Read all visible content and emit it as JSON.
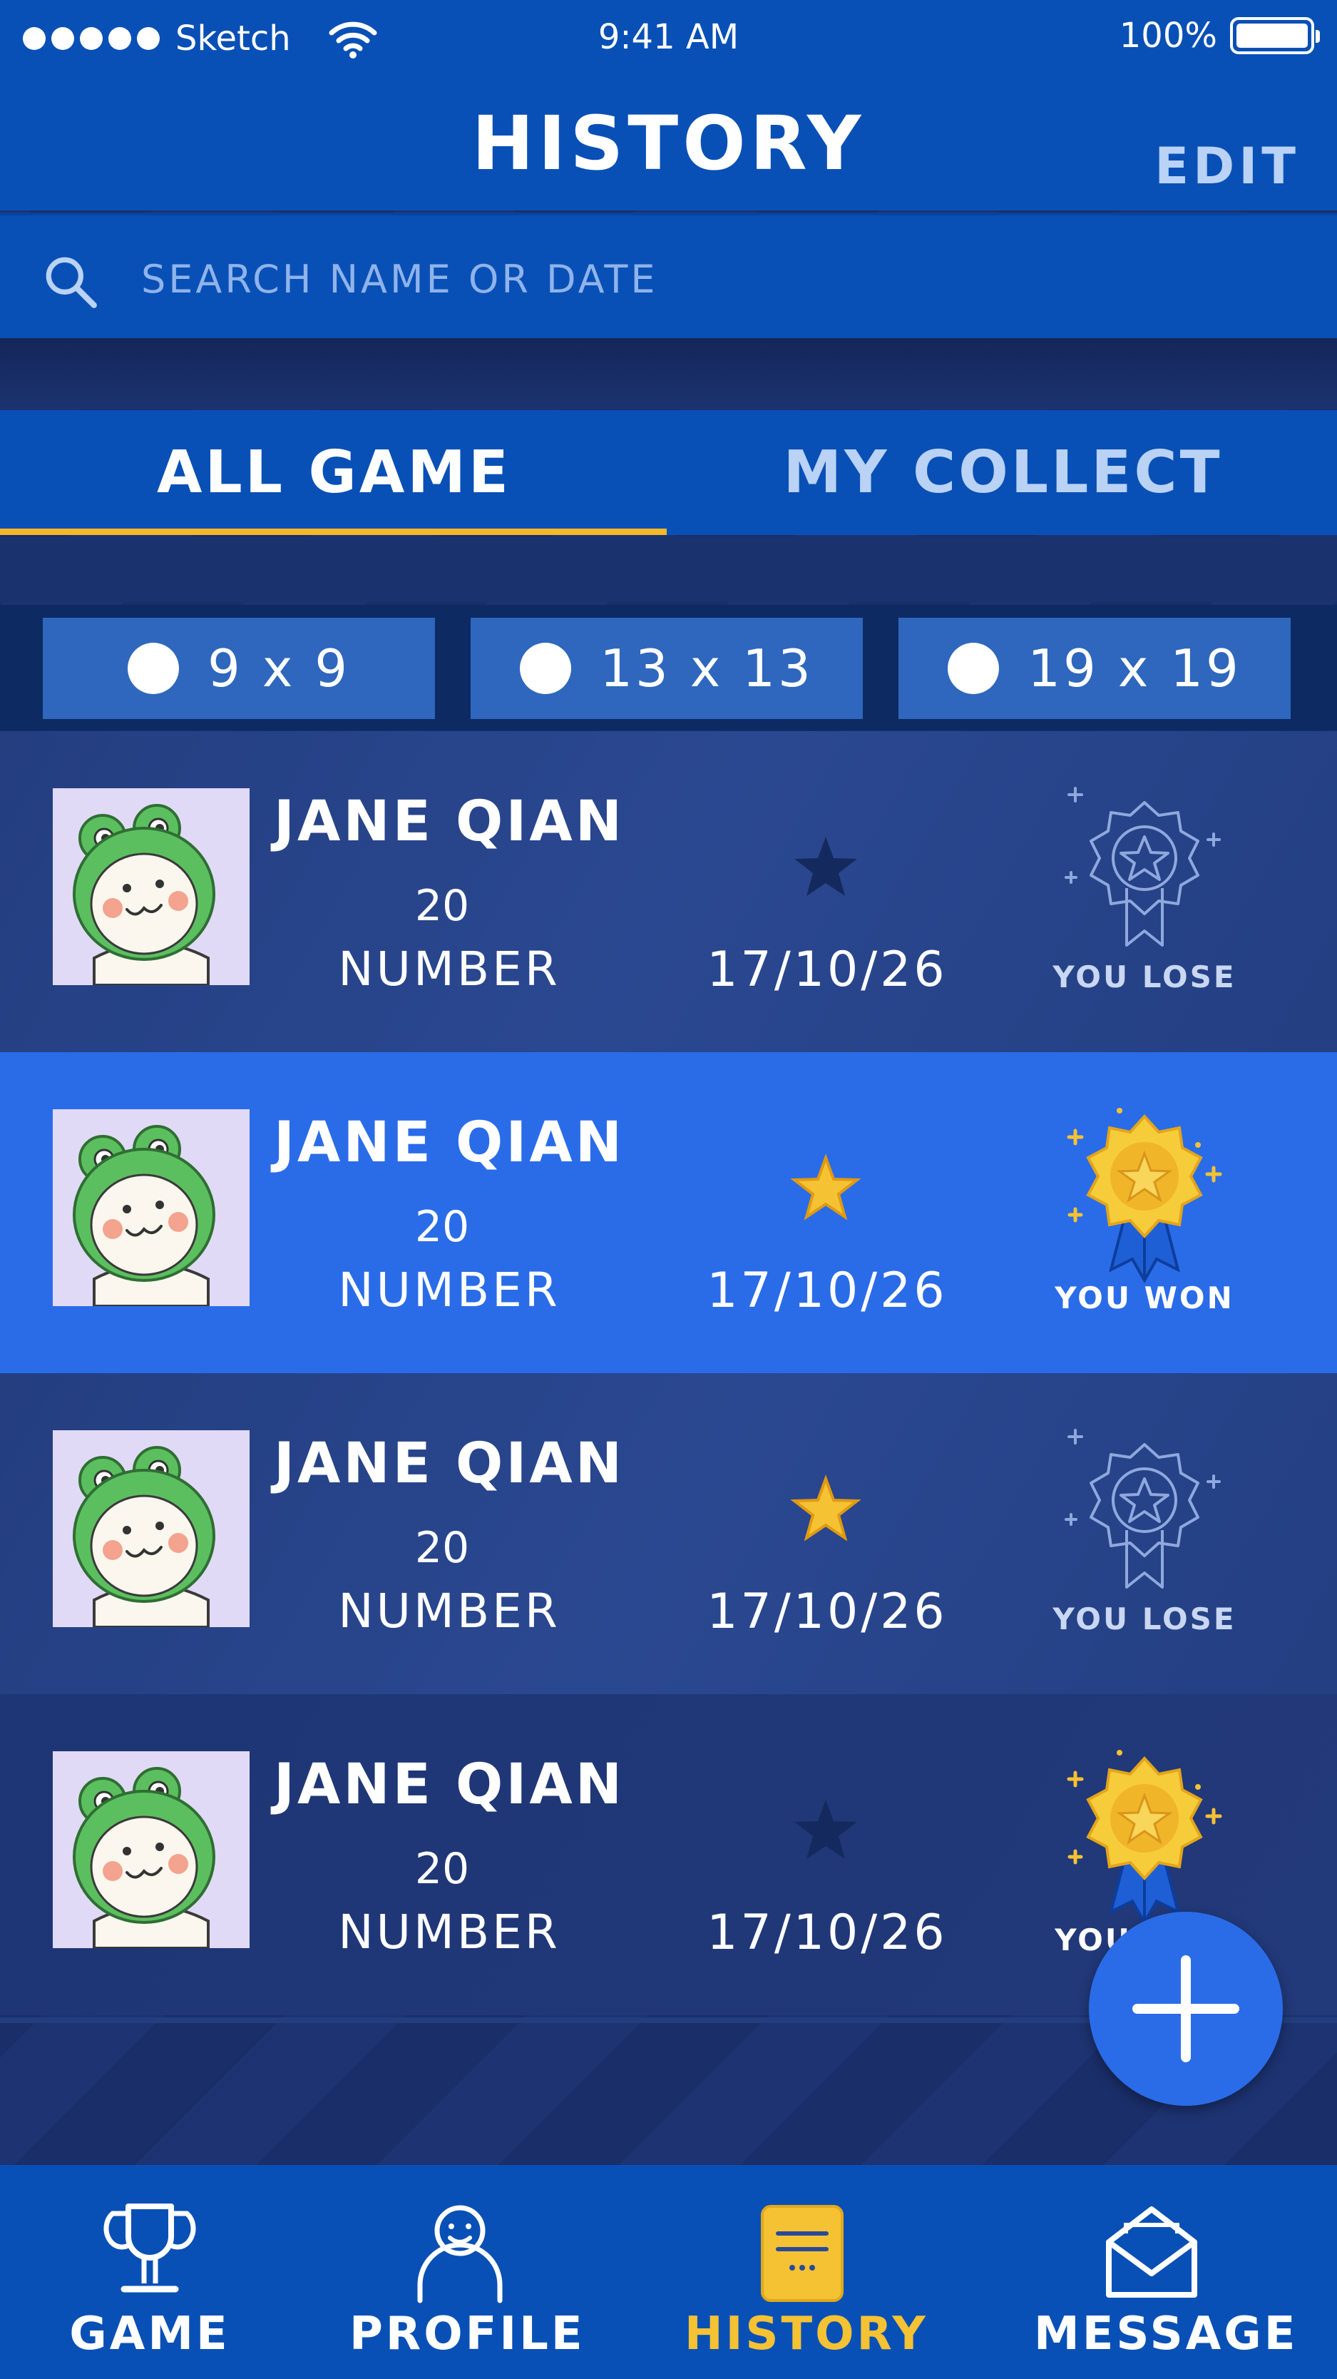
{
  "status_bar": {
    "carrier": "Sketch",
    "time": "9:41 AM",
    "battery_text": "100%",
    "battery_level": 1.0
  },
  "header": {
    "title": "HISTORY",
    "edit_label": "EDIT"
  },
  "search": {
    "placeholder": "SEARCH NAME OR DATE",
    "icon": "search-icon"
  },
  "tabs": [
    {
      "label": "ALL GAME",
      "active": true
    },
    {
      "label": "MY COLLECT",
      "active": false
    }
  ],
  "filters": [
    {
      "label": "9 x 9"
    },
    {
      "label": "13 x 13"
    },
    {
      "label": "19 x 19"
    }
  ],
  "games": [
    {
      "name": "JANE QIAN",
      "number": "20",
      "number_label": "NUMBER",
      "date": "17/10/26",
      "starred": false,
      "result": "YOU LOSE",
      "won": false
    },
    {
      "name": "JANE QIAN",
      "number": "20",
      "number_label": "NUMBER",
      "date": "17/10/26",
      "starred": true,
      "result": "YOU WON",
      "won": true
    },
    {
      "name": "JANE QIAN",
      "number": "20",
      "number_label": "NUMBER",
      "date": "17/10/26",
      "starred": true,
      "result": "YOU LOSE",
      "won": false
    },
    {
      "name": "JANE QIAN",
      "number": "20",
      "number_label": "NUMBER",
      "date": "17/10/26",
      "starred": false,
      "result": "YOU WON",
      "won": true
    }
  ],
  "fab": {
    "icon": "plus-icon"
  },
  "bottom_nav": [
    {
      "label": "GAME",
      "icon": "trophy-icon",
      "active": false
    },
    {
      "label": "PROFILE",
      "icon": "person-icon",
      "active": false
    },
    {
      "label": "HISTORY",
      "icon": "notebook-icon",
      "active": true
    },
    {
      "label": "MESSAGE",
      "icon": "envelope-icon",
      "active": false
    }
  ],
  "colors": {
    "primary": "#0950b6",
    "highlight_row": "#2a6ce8",
    "accent_yellow": "#f3b928",
    "muted_text": "#b9d2f5"
  }
}
